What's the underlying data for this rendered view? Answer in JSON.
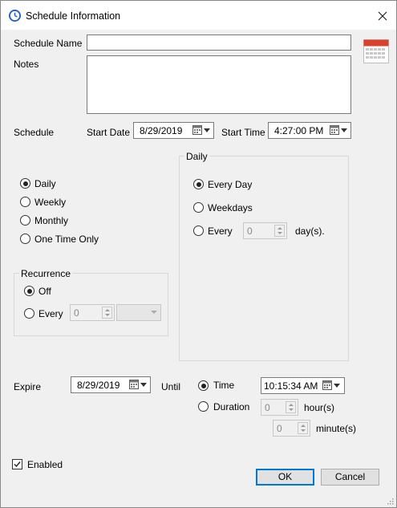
{
  "window": {
    "title": "Schedule Information"
  },
  "fields": {
    "schedule_name_label": "Schedule Name",
    "notes_label": "Notes",
    "schedule_label": "Schedule",
    "start_date_label": "Start Date",
    "start_date_value": "8/29/2019",
    "start_time_label": "Start Time",
    "start_time_value": "4:27:00 PM"
  },
  "frequency": {
    "options": [
      "Daily",
      "Weekly",
      "Monthly",
      "One Time Only"
    ],
    "selected": "Daily"
  },
  "recurrence": {
    "title": "Recurrence",
    "off_label": "Off",
    "every_label": "Every",
    "every_value": "0"
  },
  "daily": {
    "title": "Daily",
    "every_day_label": "Every Day",
    "weekdays_label": "Weekdays",
    "every_label": "Every",
    "every_value": "0",
    "days_unit": "day(s)."
  },
  "expire": {
    "label": "Expire",
    "date_value": "8/29/2019",
    "until_label": "Until",
    "time_label": "Time",
    "time_value": "10:15:34 AM",
    "duration_label": "Duration",
    "hours_value": "0",
    "hours_unit": "hour(s)",
    "minutes_value": "0",
    "minutes_unit": "minute(s)"
  },
  "enabled": {
    "label": "Enabled",
    "checked": true
  },
  "buttons": {
    "ok": "OK",
    "cancel": "Cancel"
  },
  "colors": {
    "accent": "#0078d7",
    "calendar_red": "#d9412e"
  }
}
